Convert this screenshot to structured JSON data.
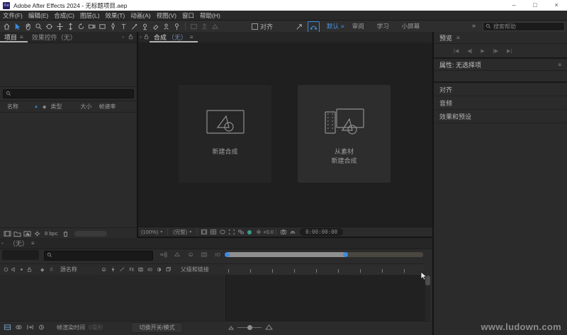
{
  "titlebar": {
    "app_badge": "Ae",
    "title": "Adobe After Effects 2024 - 无标题项目.aep",
    "minimize": "–",
    "maximize": "□",
    "close": "×"
  },
  "menubar": {
    "items": [
      "文件(F)",
      "编辑(E)",
      "合成(C)",
      "图层(L)",
      "效果(T)",
      "动画(A)",
      "视图(V)",
      "窗口",
      "帮助(H)"
    ]
  },
  "toolbar": {
    "snap_label": "对齐",
    "workspaces": [
      "默认",
      "审阅",
      "学习",
      "小屏幕"
    ],
    "search_placeholder": "搜索帮助"
  },
  "icons": {
    "menu_glyph": "≡",
    "overflow_glyph": "»",
    "sort_asc_glyph": "▲",
    "dropdown_glyph": "▾",
    "grip_glyph": "•",
    "label_glyph": "◆",
    "hash_glyph": "#"
  },
  "project": {
    "tab_project": "项目",
    "tab_effect_controls": "效果控件（无）",
    "col_name": "名称",
    "col_type": "类型",
    "col_size": "大小",
    "col_frame_rate": "帧速率",
    "bit_depth": "8 bpc"
  },
  "comp": {
    "tab_title": "合成",
    "tab_none": "（无）",
    "new_comp_label": "新建合成",
    "from_footage_line1": "从素材",
    "from_footage_line2": "新建合成",
    "magnification": "(100%)",
    "resolution": "(完整)",
    "exposure": "+0.0",
    "timecode": "0:00:00:00"
  },
  "sidebar": {
    "preview_title": "预览",
    "transport": [
      "|◀",
      "◀|",
      "▶",
      "|▶",
      "▶|"
    ],
    "properties_title": "属性: 无选择项",
    "align_title": "对齐",
    "audio_title": "音频",
    "effects_title": "效果和预设"
  },
  "timeline": {
    "tab_label": "（无）",
    "col_source_name": "源名称",
    "col_parent_link": "父级和链接",
    "render_time_label": "帧渲染时间",
    "render_time_value": "0毫秒",
    "toggle_modes_label": "切换开关/模式"
  },
  "watermark": "www.ludown.com",
  "colors": {
    "accent_blue": "#3f8ae0",
    "titlebar_bg": "#ffffff",
    "panel_bg": "#2b2b2b",
    "viewer_bg": "#1f1f1f"
  }
}
